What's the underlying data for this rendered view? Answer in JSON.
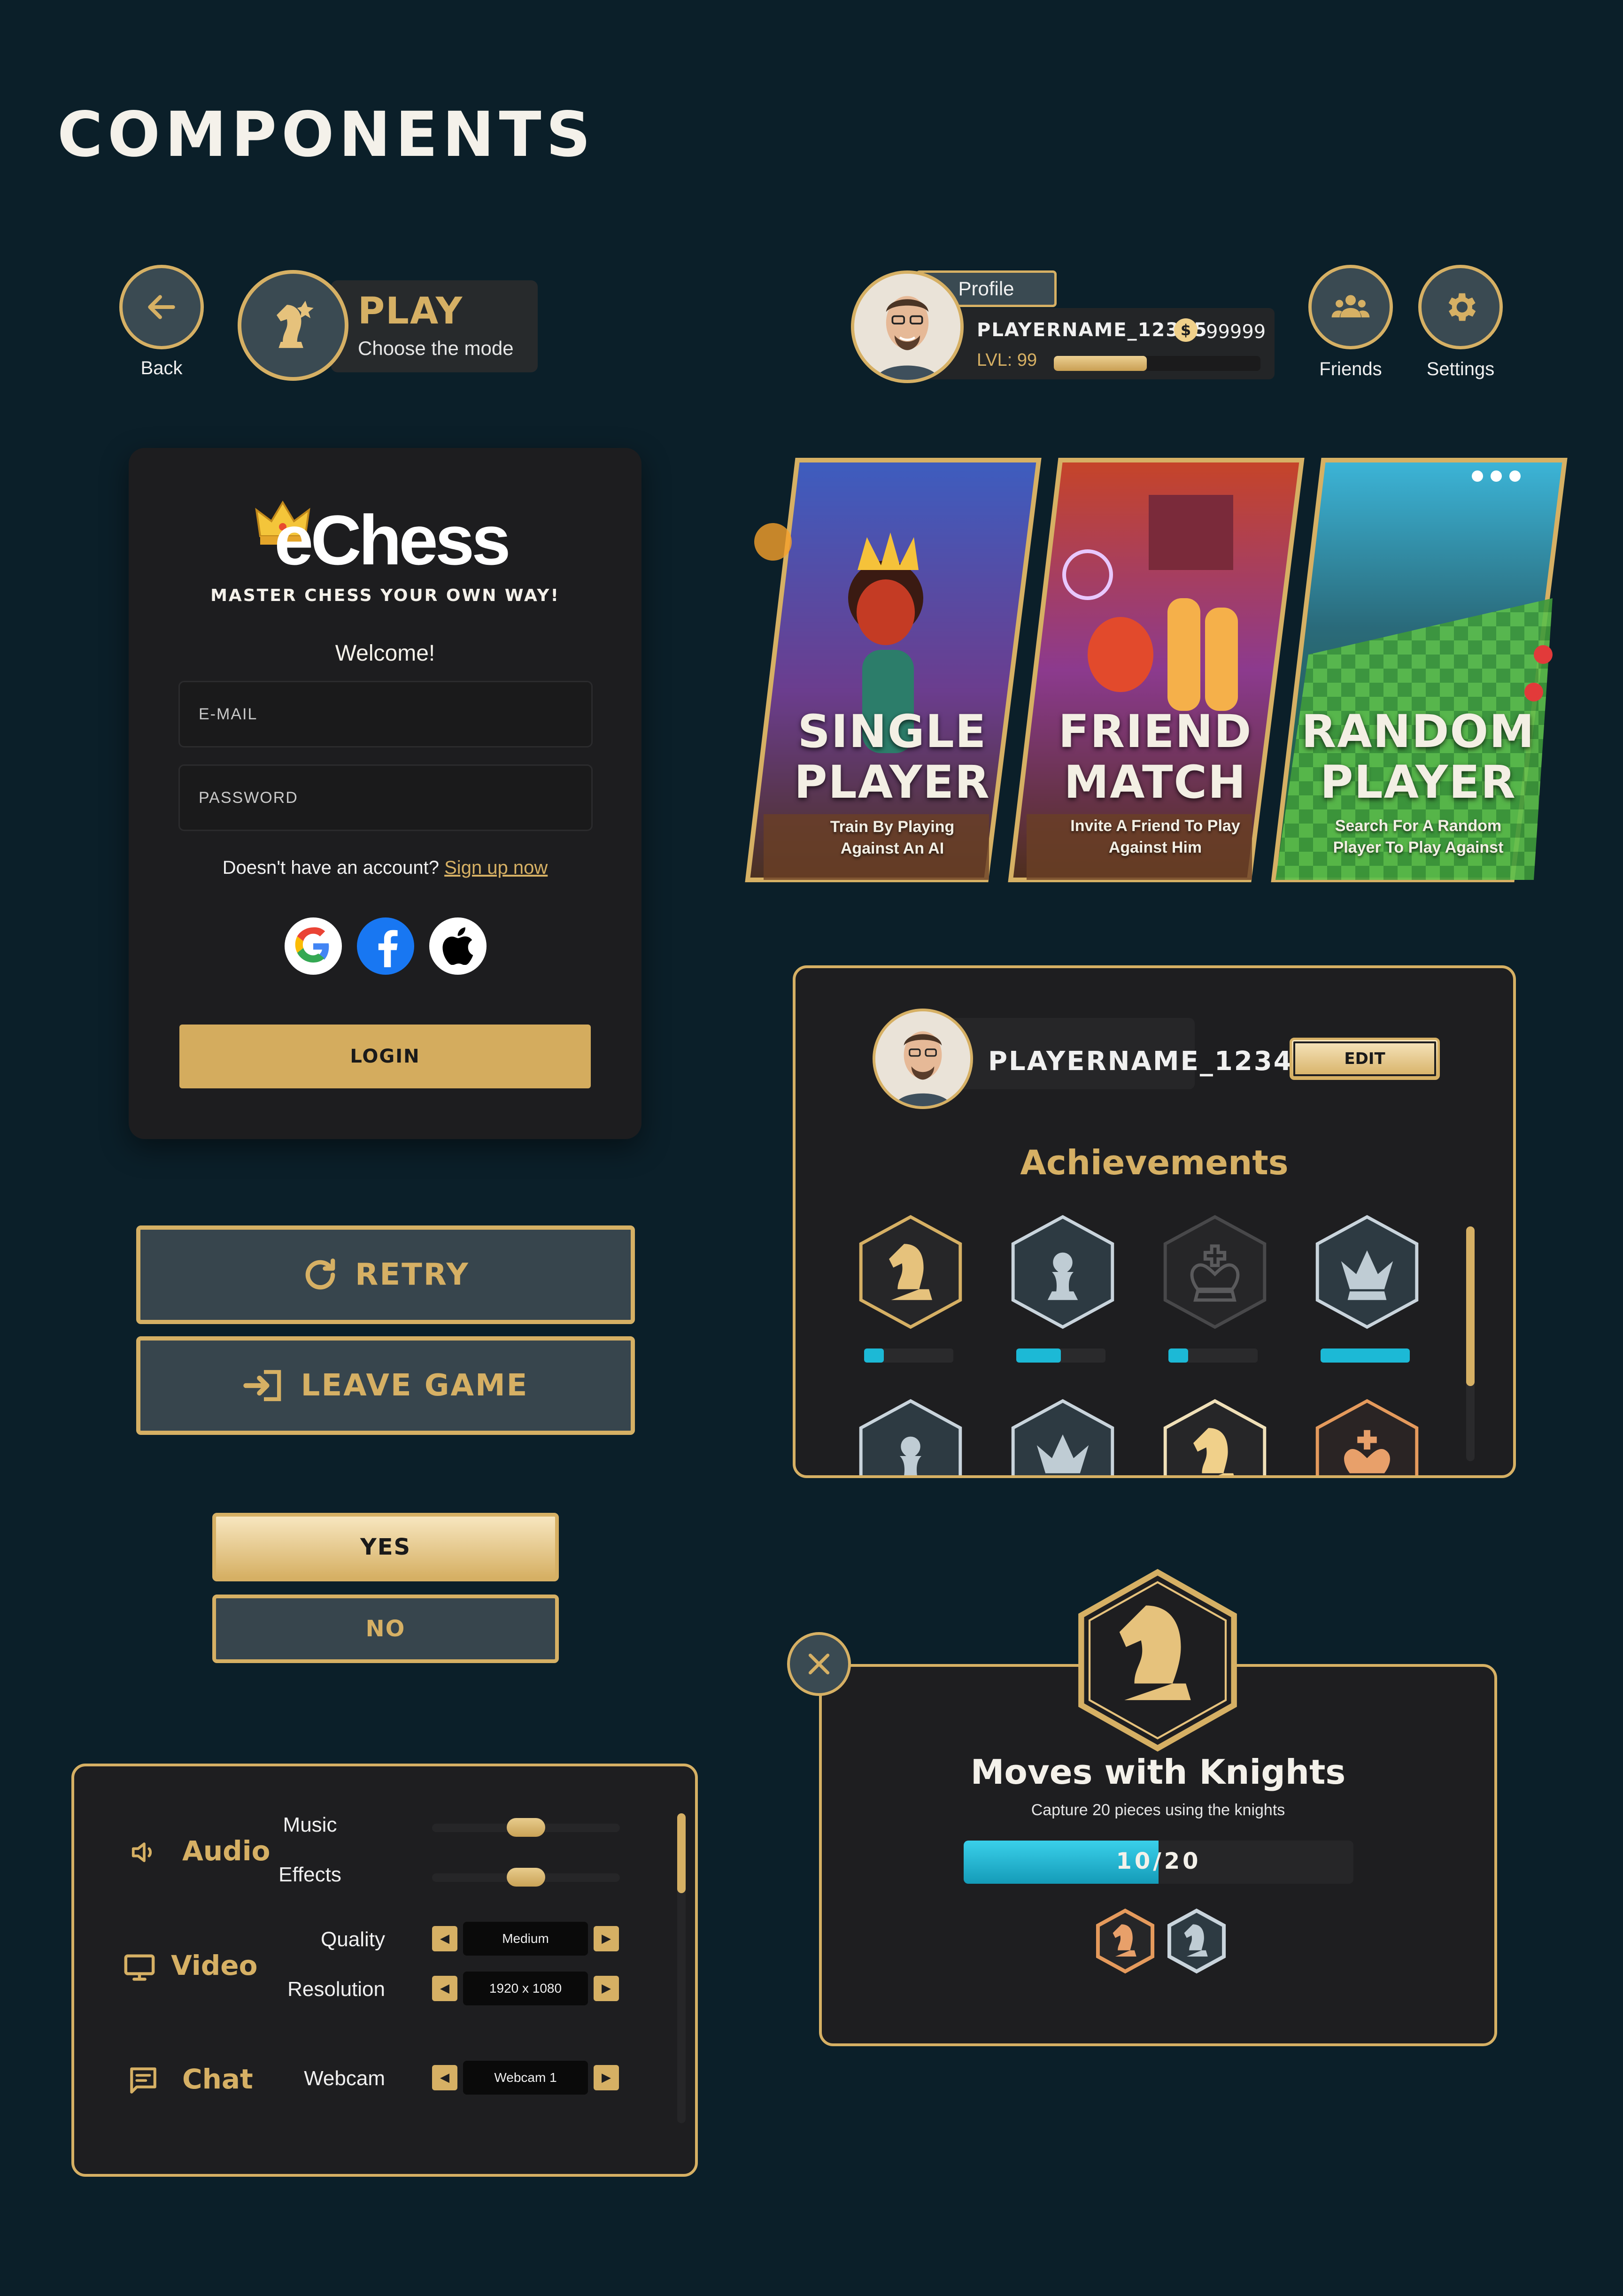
{
  "page": {
    "title": "COMPONENTS"
  },
  "nav": {
    "back_label": "Back",
    "play_title": "PLAY",
    "play_subtitle": "Choose the mode",
    "friends_label": "Friends",
    "settings_label": "Settings"
  },
  "profile": {
    "tab_label": "Profile",
    "player_name": "PLAYERNAME_12345",
    "coins": "99999",
    "level_text": "LVL: 99",
    "level_progress": 0.45
  },
  "login": {
    "brand": "eChess",
    "tagline": "MASTER CHESS YOUR OWN WAY!",
    "welcome": "Welcome!",
    "email_placeholder": "E-MAIL",
    "password_placeholder": "PASSWORD",
    "no_account_text": "Doesn't have an account?",
    "signup_link": "Sign up now",
    "login_button": "LOGIN",
    "social": [
      "google-icon",
      "facebook-icon",
      "apple-icon"
    ]
  },
  "modes": [
    {
      "title_line1": "SINGLE",
      "title_line2": "PLAYER",
      "sub_line1": "Train By Playing",
      "sub_line2": "Against An AI"
    },
    {
      "title_line1": "FRIEND",
      "title_line2": "MATCH",
      "sub_line1": "Invite A Friend To Play",
      "sub_line2": "Against Him"
    },
    {
      "title_line1": "RANDOM",
      "title_line2": "PLAYER",
      "sub_line1": "Search For A Random",
      "sub_line2": "Player To Play Against"
    }
  ],
  "buttons": {
    "retry": "RETRY",
    "leave_game": "LEAVE GAME",
    "yes": "YES",
    "no": "NO"
  },
  "achievements_panel": {
    "player_name": "PLAYERNAME_12345",
    "edit_button": "EDIT",
    "title": "Achievements",
    "items": [
      {
        "icon": "knight-icon",
        "progress": 0.22
      },
      {
        "icon": "pawn-icon",
        "progress": 0.5
      },
      {
        "icon": "king-icon",
        "progress": 0.22
      },
      {
        "icon": "queen-icon",
        "progress": 1.0
      },
      {
        "icon": "pawn-icon"
      },
      {
        "icon": "queen-icon"
      },
      {
        "icon": "knight-icon"
      },
      {
        "icon": "king-icon"
      }
    ]
  },
  "settings": {
    "categories": [
      "Audio",
      "Video",
      "Chat"
    ],
    "music_label": "Music",
    "music_level": 0.5,
    "effects_label": "Effects",
    "effects_level": 0.5,
    "quality_label": "Quality",
    "quality_value": "Medium",
    "resolution_label": "Resolution",
    "resolution_value": "1920 x 1080",
    "webcam_label": "Webcam",
    "webcam_value": "Webcam 1"
  },
  "achievement_popup": {
    "title": "Moves with Knights",
    "description": "Capture 20 pieces using the knights",
    "progress_text": "10/20",
    "progress": 0.5
  },
  "colors": {
    "background": "#0b1f29",
    "gold": "#d6b064",
    "panel": "#1e1e20",
    "cyan": "#1cb9d6"
  }
}
